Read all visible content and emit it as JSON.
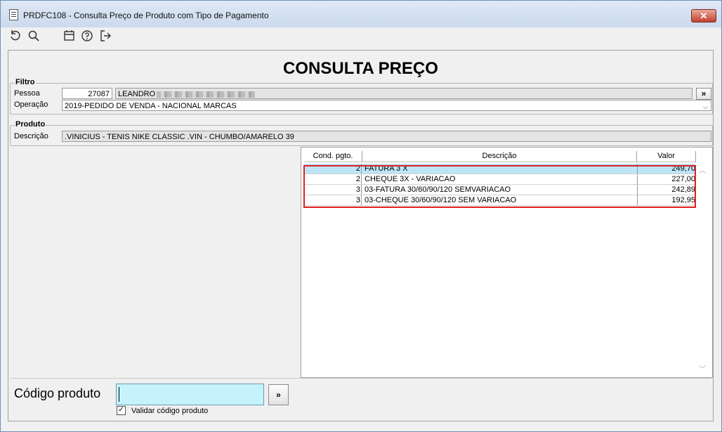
{
  "window": {
    "title": "PRDFC108 - Consulta Preço de Produto com Tipo de Pagamento",
    "close_label": "✕"
  },
  "toolbar": {
    "icons": [
      "undo-icon",
      "search-icon",
      "calendar-icon",
      "help-icon",
      "exit-icon"
    ]
  },
  "heading": "CONSULTA PREÇO",
  "filtro": {
    "legend": "Filtro",
    "pessoa_label": "Pessoa",
    "pessoa_code": "27087",
    "pessoa_name": "LEANDRO",
    "pessoa_button": "»",
    "operacao_label": "Operação",
    "operacao_value": "2019-PEDIDO DE VENDA - NACIONAL MARCAS"
  },
  "produto": {
    "legend": "Produto",
    "descricao_label": "Descrição",
    "descricao_value": ".VINICIUS - TENIS NIKE CLASSIC .VIN - CHUMBO/AMARELO 39"
  },
  "grid": {
    "headers": [
      "Cond. pgto.",
      "Descrição",
      "Valor"
    ],
    "rows": [
      {
        "cond": "2",
        "descricao": "FATURA 3 X",
        "valor": "249,70"
      },
      {
        "cond": "2",
        "descricao": "CHEQUE 3X - VARIACAO",
        "valor": "227,00"
      },
      {
        "cond": "3",
        "descricao": "03-FATURA 30/60/90/120 SEMVARIACAO",
        "valor": "242,89"
      },
      {
        "cond": "3",
        "descricao": "03-CHEQUE 30/60/90/120 SEM VARIACAO",
        "valor": "192,95"
      }
    ],
    "selected_row": 0
  },
  "bottom": {
    "codigo_label": "Código produto",
    "codigo_value": "",
    "codigo_button": "»",
    "validar_label": "Validar código produto",
    "validar_checked": true
  },
  "colors": {
    "selection": "#bde5f8",
    "input_highlight": "#c6f3fb",
    "annotation_red": "#e02020"
  }
}
